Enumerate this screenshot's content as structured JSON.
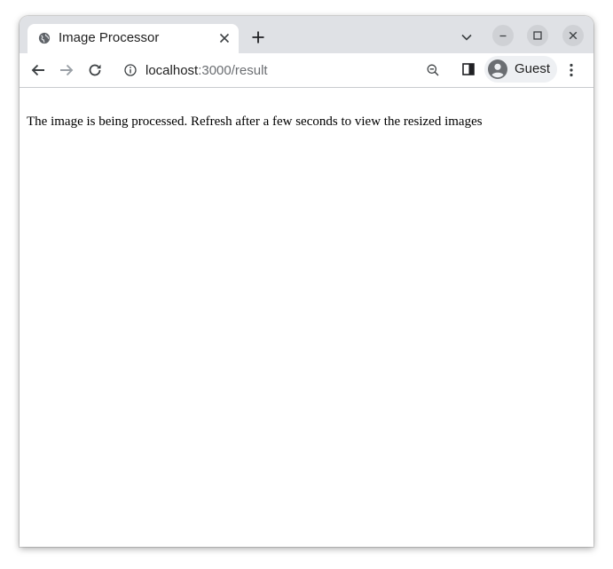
{
  "browser": {
    "tab": {
      "title": "Image Processor"
    },
    "address_bar": {
      "host": "localhost",
      "path": ":3000/result"
    },
    "profile": {
      "label": "Guest"
    }
  },
  "page": {
    "message": "The image is being processed. Refresh after a few seconds to view the resized images"
  },
  "icons": {
    "favicon": "globe-icon",
    "tab_close": "close-icon",
    "new_tab": "plus-icon",
    "tab_search": "chevron-down-icon",
    "back": "arrow-left-icon",
    "forward": "arrow-right-icon",
    "reload": "reload-icon",
    "site_info": "info-icon",
    "zoom": "zoom-out-icon",
    "side_panel": "side-panel-icon",
    "avatar": "person-icon",
    "menu": "kebab-menu-icon"
  },
  "colors": {
    "tabstrip": "#dfe1e5",
    "active_tab": "#ffffff",
    "text": "#1f1f1f",
    "url_path": "#6b6e72",
    "disabled_icon": "#9aa0a6"
  }
}
